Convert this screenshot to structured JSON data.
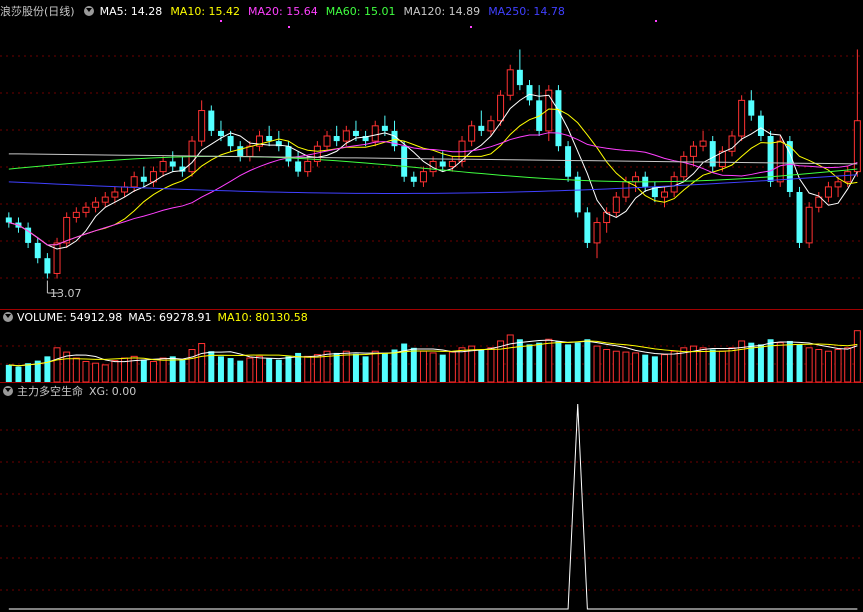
{
  "main_panel": {
    "stock_name": "浪莎股份",
    "period": "(日线)",
    "ma_readouts": [
      {
        "label": "MA5:",
        "value": "14.28",
        "color": "#ffffff"
      },
      {
        "label": "MA10:",
        "value": "15.42",
        "color": "#ffff00"
      },
      {
        "label": "MA20:",
        "value": "15.64",
        "color": "#ff40ff"
      },
      {
        "label": "MA60:",
        "value": "15.01",
        "color": "#40ff40"
      },
      {
        "label": "MA120:",
        "value": "14.89",
        "color": "#c8c8c8"
      },
      {
        "label": "MA250:",
        "value": "14.78",
        "color": "#4040ff"
      }
    ],
    "low_price_label": "13.07"
  },
  "volume_panel": {
    "title": "VOLUME:",
    "value": "54912.98",
    "ma5_label": "MA5:",
    "ma5_value": "69278.91",
    "ma10_label": "MA10:",
    "ma10_value": "80130.58"
  },
  "indicator_panel": {
    "title": "主力多空生命",
    "xg_label": "XG:",
    "xg_value": "0.00"
  },
  "colors": {
    "up": "#ff3232",
    "down": "#54ffff",
    "grid": "#6e0000",
    "divider": "#a00000"
  },
  "chart_data": {
    "type": "candlestick",
    "candles": [
      {
        "o": 14.3,
        "h": 14.4,
        "l": 14.1,
        "c": 14.2
      },
      {
        "o": 14.2,
        "h": 14.3,
        "l": 14.0,
        "c": 14.1
      },
      {
        "o": 14.1,
        "h": 14.2,
        "l": 13.7,
        "c": 13.8
      },
      {
        "o": 13.8,
        "h": 13.9,
        "l": 13.4,
        "c": 13.5
      },
      {
        "o": 13.5,
        "h": 13.6,
        "l": 13.1,
        "c": 13.2
      },
      {
        "o": 13.2,
        "h": 13.9,
        "l": 13.1,
        "c": 13.8
      },
      {
        "o": 13.8,
        "h": 14.4,
        "l": 13.7,
        "c": 14.3
      },
      {
        "o": 14.3,
        "h": 14.5,
        "l": 14.2,
        "c": 14.4
      },
      {
        "o": 14.4,
        "h": 14.6,
        "l": 14.3,
        "c": 14.5
      },
      {
        "o": 14.5,
        "h": 14.7,
        "l": 14.4,
        "c": 14.6
      },
      {
        "o": 14.6,
        "h": 14.8,
        "l": 14.5,
        "c": 14.7
      },
      {
        "o": 14.7,
        "h": 14.9,
        "l": 14.6,
        "c": 14.8
      },
      {
        "o": 14.8,
        "h": 15.0,
        "l": 14.7,
        "c": 14.9
      },
      {
        "o": 14.9,
        "h": 15.2,
        "l": 14.8,
        "c": 15.1
      },
      {
        "o": 15.1,
        "h": 15.3,
        "l": 14.9,
        "c": 15.0
      },
      {
        "o": 15.0,
        "h": 15.3,
        "l": 14.9,
        "c": 15.2
      },
      {
        "o": 15.2,
        "h": 15.5,
        "l": 15.1,
        "c": 15.4
      },
      {
        "o": 15.4,
        "h": 15.6,
        "l": 15.2,
        "c": 15.3
      },
      {
        "o": 15.3,
        "h": 15.5,
        "l": 15.1,
        "c": 15.2
      },
      {
        "o": 15.2,
        "h": 15.9,
        "l": 15.1,
        "c": 15.8
      },
      {
        "o": 15.8,
        "h": 16.6,
        "l": 15.7,
        "c": 16.4
      },
      {
        "o": 16.4,
        "h": 16.5,
        "l": 15.9,
        "c": 16.0
      },
      {
        "o": 16.0,
        "h": 16.2,
        "l": 15.8,
        "c": 15.9
      },
      {
        "o": 15.9,
        "h": 16.0,
        "l": 15.6,
        "c": 15.7
      },
      {
        "o": 15.7,
        "h": 15.8,
        "l": 15.4,
        "c": 15.5
      },
      {
        "o": 15.5,
        "h": 15.8,
        "l": 15.4,
        "c": 15.7
      },
      {
        "o": 15.7,
        "h": 16.0,
        "l": 15.6,
        "c": 15.9
      },
      {
        "o": 15.9,
        "h": 16.1,
        "l": 15.7,
        "c": 15.8
      },
      {
        "o": 15.8,
        "h": 16.0,
        "l": 15.6,
        "c": 15.7
      },
      {
        "o": 15.7,
        "h": 15.8,
        "l": 15.3,
        "c": 15.4
      },
      {
        "o": 15.4,
        "h": 15.6,
        "l": 15.1,
        "c": 15.2
      },
      {
        "o": 15.2,
        "h": 15.5,
        "l": 15.1,
        "c": 15.4
      },
      {
        "o": 15.4,
        "h": 15.8,
        "l": 15.3,
        "c": 15.7
      },
      {
        "o": 15.7,
        "h": 16.0,
        "l": 15.6,
        "c": 15.9
      },
      {
        "o": 15.9,
        "h": 16.1,
        "l": 15.7,
        "c": 15.8
      },
      {
        "o": 15.8,
        "h": 16.1,
        "l": 15.7,
        "c": 16.0
      },
      {
        "o": 16.0,
        "h": 16.2,
        "l": 15.8,
        "c": 15.9
      },
      {
        "o": 15.9,
        "h": 16.0,
        "l": 15.7,
        "c": 15.8
      },
      {
        "o": 15.8,
        "h": 16.2,
        "l": 15.7,
        "c": 16.1
      },
      {
        "o": 16.1,
        "h": 16.3,
        "l": 15.9,
        "c": 16.0
      },
      {
        "o": 16.0,
        "h": 16.2,
        "l": 15.6,
        "c": 15.7
      },
      {
        "o": 15.7,
        "h": 15.8,
        "l": 15.0,
        "c": 15.1
      },
      {
        "o": 15.1,
        "h": 15.2,
        "l": 14.9,
        "c": 15.0
      },
      {
        "o": 15.0,
        "h": 15.3,
        "l": 14.9,
        "c": 15.2
      },
      {
        "o": 15.2,
        "h": 15.5,
        "l": 15.1,
        "c": 15.4
      },
      {
        "o": 15.4,
        "h": 15.6,
        "l": 15.2,
        "c": 15.3
      },
      {
        "o": 15.3,
        "h": 15.5,
        "l": 15.2,
        "c": 15.4
      },
      {
        "o": 15.4,
        "h": 15.9,
        "l": 15.3,
        "c": 15.8
      },
      {
        "o": 15.8,
        "h": 16.2,
        "l": 15.7,
        "c": 16.1
      },
      {
        "o": 16.1,
        "h": 16.4,
        "l": 15.9,
        "c": 16.0
      },
      {
        "o": 16.0,
        "h": 16.3,
        "l": 15.9,
        "c": 16.2
      },
      {
        "o": 16.2,
        "h": 16.8,
        "l": 16.1,
        "c": 16.7
      },
      {
        "o": 16.7,
        "h": 17.3,
        "l": 16.6,
        "c": 17.2
      },
      {
        "o": 17.2,
        "h": 17.6,
        "l": 16.8,
        "c": 16.9
      },
      {
        "o": 16.9,
        "h": 17.0,
        "l": 16.5,
        "c": 16.6
      },
      {
        "o": 16.6,
        "h": 16.9,
        "l": 15.9,
        "c": 16.0
      },
      {
        "o": 16.0,
        "h": 16.9,
        "l": 15.8,
        "c": 16.8
      },
      {
        "o": 16.8,
        "h": 16.9,
        "l": 15.6,
        "c": 15.7
      },
      {
        "o": 15.7,
        "h": 15.8,
        "l": 15.0,
        "c": 15.1
      },
      {
        "o": 15.1,
        "h": 15.2,
        "l": 14.3,
        "c": 14.4
      },
      {
        "o": 14.4,
        "h": 14.5,
        "l": 13.7,
        "c": 13.8
      },
      {
        "o": 13.8,
        "h": 14.3,
        "l": 13.5,
        "c": 14.2
      },
      {
        "o": 14.2,
        "h": 14.5,
        "l": 14.0,
        "c": 14.4
      },
      {
        "o": 14.4,
        "h": 14.8,
        "l": 14.3,
        "c": 14.7
      },
      {
        "o": 14.7,
        "h": 15.1,
        "l": 14.6,
        "c": 15.0
      },
      {
        "o": 15.0,
        "h": 15.2,
        "l": 14.8,
        "c": 15.1
      },
      {
        "o": 15.1,
        "h": 15.2,
        "l": 14.8,
        "c": 14.9
      },
      {
        "o": 14.9,
        "h": 15.0,
        "l": 14.6,
        "c": 14.7
      },
      {
        "o": 14.7,
        "h": 14.9,
        "l": 14.5,
        "c": 14.8
      },
      {
        "o": 14.8,
        "h": 15.2,
        "l": 14.7,
        "c": 15.1
      },
      {
        "o": 15.1,
        "h": 15.6,
        "l": 15.0,
        "c": 15.5
      },
      {
        "o": 15.5,
        "h": 15.8,
        "l": 15.3,
        "c": 15.7
      },
      {
        "o": 15.7,
        "h": 16.0,
        "l": 15.6,
        "c": 15.8
      },
      {
        "o": 15.8,
        "h": 15.9,
        "l": 15.2,
        "c": 15.3
      },
      {
        "o": 15.3,
        "h": 15.7,
        "l": 15.2,
        "c": 15.6
      },
      {
        "o": 15.6,
        "h": 16.0,
        "l": 15.5,
        "c": 15.9
      },
      {
        "o": 15.9,
        "h": 16.7,
        "l": 15.8,
        "c": 16.6
      },
      {
        "o": 16.6,
        "h": 16.8,
        "l": 16.2,
        "c": 16.3
      },
      {
        "o": 16.3,
        "h": 16.4,
        "l": 15.8,
        "c": 15.9
      },
      {
        "o": 15.9,
        "h": 16.0,
        "l": 14.9,
        "c": 15.0
      },
      {
        "o": 15.0,
        "h": 15.9,
        "l": 14.9,
        "c": 15.8
      },
      {
        "o": 15.8,
        "h": 15.9,
        "l": 14.7,
        "c": 14.8
      },
      {
        "o": 14.8,
        "h": 14.9,
        "l": 13.7,
        "c": 13.8
      },
      {
        "o": 13.8,
        "h": 14.6,
        "l": 13.7,
        "c": 14.5
      },
      {
        "o": 14.5,
        "h": 14.8,
        "l": 14.4,
        "c": 14.7
      },
      {
        "o": 14.7,
        "h": 15.0,
        "l": 14.6,
        "c": 14.9
      },
      {
        "o": 14.9,
        "h": 15.1,
        "l": 14.7,
        "c": 15.0
      },
      {
        "o": 15.0,
        "h": 15.3,
        "l": 14.9,
        "c": 15.2
      },
      {
        "o": 15.2,
        "h": 17.6,
        "l": 15.1,
        "c": 16.2
      }
    ],
    "volume": [
      20,
      18,
      22,
      25,
      30,
      40,
      35,
      28,
      24,
      22,
      20,
      25,
      28,
      30,
      26,
      24,
      28,
      30,
      26,
      38,
      45,
      36,
      30,
      28,
      25,
      28,
      30,
      28,
      26,
      30,
      34,
      30,
      32,
      36,
      34,
      36,
      33,
      30,
      36,
      34,
      38,
      45,
      40,
      36,
      34,
      32,
      35,
      40,
      42,
      38,
      40,
      48,
      55,
      50,
      44,
      46,
      50,
      48,
      44,
      46,
      50,
      42,
      38,
      36,
      35,
      34,
      32,
      30,
      32,
      36,
      40,
      42,
      40,
      38,
      36,
      40,
      48,
      46,
      44,
      50,
      46,
      48,
      44,
      40,
      38,
      36,
      38,
      40,
      60
    ],
    "xg_signal_index": 59,
    "xg_signal_value": 1,
    "price_range": [
      12.6,
      18.1
    ]
  }
}
